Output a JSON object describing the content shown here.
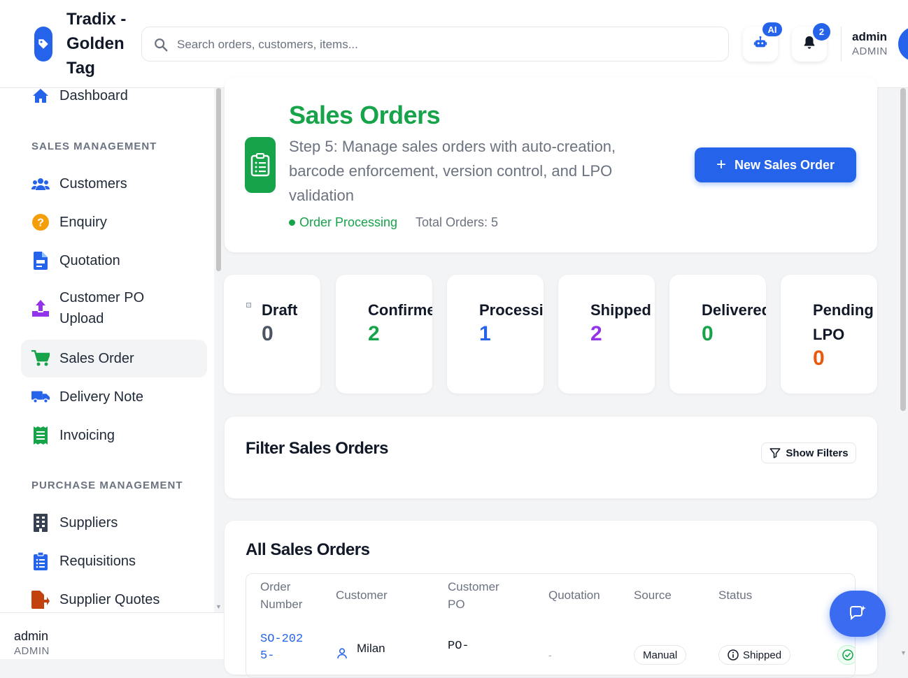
{
  "header": {
    "brand": "Tradix - Golden Tag",
    "search_placeholder": "Search orders, customers, items...",
    "ai_badge": "AI",
    "notif_count": "2",
    "user_name": "admin",
    "user_role": "ADMIN"
  },
  "sidebar": {
    "dashboard": "Dashboard",
    "sales_section": "SALES MANAGEMENT",
    "sales_items": [
      "Customers",
      "Enquiry",
      "Quotation",
      "Customer PO Upload",
      "Sales Order",
      "Delivery Note",
      "Invoicing"
    ],
    "purchase_section": "PURCHASE MANAGEMENT",
    "purchase_items": [
      "Suppliers",
      "Requisitions",
      "Supplier Quotes"
    ],
    "footer_name": "admin",
    "footer_role": "ADMIN"
  },
  "hero": {
    "title": "Sales Orders",
    "subtitle": "Step 5: Manage sales orders with auto-creation, barcode enforcement, version control, and LPO validation",
    "status": "Order Processing",
    "total": "Total Orders: 5",
    "new_button": "New Sales Order"
  },
  "stats": [
    {
      "label": "Draft",
      "value": "0",
      "color": "#4b5563"
    },
    {
      "label": "Confirmed",
      "value": "2",
      "color": "#16a34a"
    },
    {
      "label": "Processing",
      "value": "1",
      "color": "#2563eb"
    },
    {
      "label": "Shipped",
      "value": "2",
      "color": "#9333ea"
    },
    {
      "label": "Delivered",
      "value": "0",
      "color": "#16a34a"
    },
    {
      "label": "Pending LPO",
      "value": "0",
      "color": "#ea580c"
    }
  ],
  "filters": {
    "title": "Filter Sales Orders",
    "button": "Show Filters"
  },
  "orders": {
    "title": "All Sales Orders",
    "columns": [
      "Order Number",
      "Customer",
      "Customer PO",
      "Quotation",
      "Source",
      "Status"
    ],
    "row": {
      "order_number": "SO-2025-",
      "customer": "Milan",
      "customer_po": "PO-",
      "quotation": "-",
      "source": "Manual",
      "status": "Shipped"
    }
  },
  "colors": {
    "primary": "#2563eb",
    "success": "#16a34a"
  }
}
